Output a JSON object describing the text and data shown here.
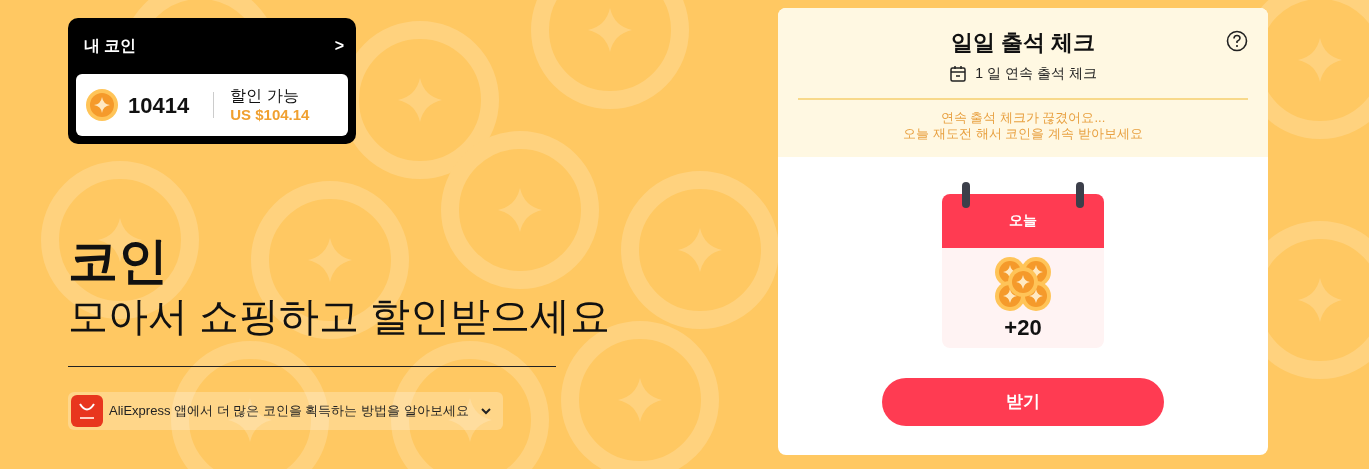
{
  "coin_card": {
    "title": "내 코인",
    "arrow": ">",
    "balance": "10414",
    "discount_label": "할인 가능",
    "discount_value": "US $104.14"
  },
  "hero": {
    "title": "코인",
    "subtitle": "모아서 쇼핑하고 할인받으세요"
  },
  "promo": {
    "text": "AliExpress 앱에서 더 많은 코인을 획득하는 방법을 알아보세요",
    "expanded": false
  },
  "checkin": {
    "title": "일일 출석 체크",
    "streak": "1 일 연속 출석 체크",
    "notice": [
      "연속 출석 체크가 끊겼어요...",
      "오늘 재도전 해서 코인을 계속 받아보세요"
    ],
    "day": {
      "label": "오늘",
      "reward": "+20"
    },
    "button": "받기"
  }
}
